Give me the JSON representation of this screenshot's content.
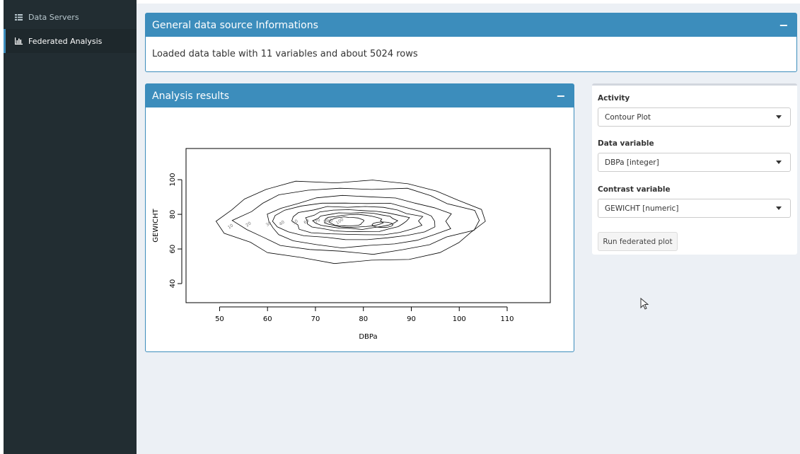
{
  "sidebar": {
    "items": [
      {
        "label": "Data Servers",
        "icon": "table-icon",
        "active": false
      },
      {
        "label": "Federated Analysis",
        "icon": "bar-chart-icon",
        "active": true
      }
    ]
  },
  "info_box": {
    "title": "General data source Informations",
    "collapse": "−",
    "text": "Loaded data table with 11 variables and about 5024 rows"
  },
  "results_box": {
    "title": "Analysis results",
    "collapse": "−"
  },
  "controls": {
    "activity_label": "Activity",
    "activity_value": "Contour Plot",
    "data_var_label": "Data variable",
    "data_var_value": "DBPa [integer]",
    "contrast_var_label": "Contrast variable",
    "contrast_var_value": "GEWICHT [numeric]",
    "run_button": "Run federated plot"
  },
  "colors": {
    "primary": "#3c8dbc",
    "sidebar_bg": "#222d32",
    "content_bg": "#ecf0f5"
  },
  "chart_data": {
    "type": "contour",
    "xlabel": "DBPa",
    "ylabel": "GEWICHT",
    "xlim": [
      43,
      119
    ],
    "ylim": [
      29,
      118
    ],
    "xticks": [
      50,
      60,
      70,
      80,
      90,
      100,
      110
    ],
    "yticks": [
      40,
      60,
      80,
      100
    ],
    "levels": [
      10,
      20,
      30,
      40,
      50,
      60,
      70,
      80,
      90,
      100
    ],
    "contour_labels": [
      "10",
      "20",
      "30",
      "40",
      "50",
      "60",
      "70",
      "80",
      "90",
      "100"
    ],
    "peaks": [
      {
        "x": 76,
        "y": 75
      },
      {
        "x": 84,
        "y": 74
      }
    ]
  }
}
